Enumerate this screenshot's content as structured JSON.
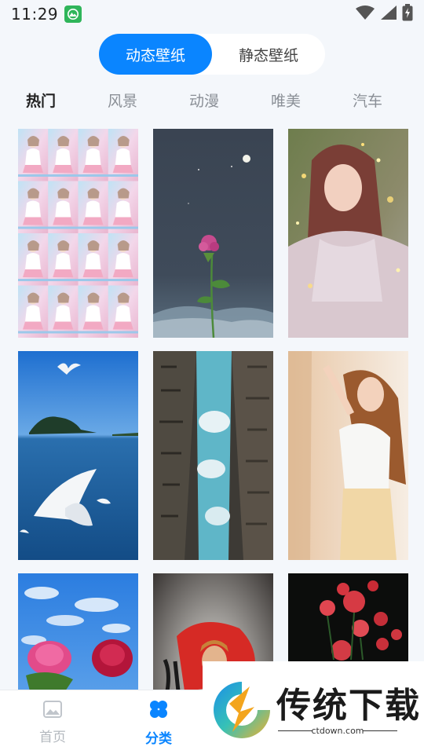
{
  "status_bar": {
    "time": "11:29",
    "app_icon": "mountain-app-icon",
    "icons": [
      "wifi-icon",
      "signal-icon",
      "battery-charging-icon"
    ]
  },
  "segment": {
    "active": "动态壁纸",
    "inactive": "静态壁纸",
    "accent": "#0a85ff"
  },
  "categories": [
    "热门",
    "风景",
    "动漫",
    "唯美",
    "汽车"
  ],
  "active_category": "热门",
  "wallpapers": [
    {
      "subject": "girl-collage",
      "icon": "wallpaper-thumbnail"
    },
    {
      "subject": "flower-night-moon",
      "icon": "wallpaper-thumbnail"
    },
    {
      "subject": "girl-sweater-sparkle",
      "icon": "wallpaper-thumbnail"
    },
    {
      "subject": "seagulls-lake-island",
      "icon": "wallpaper-thumbnail"
    },
    {
      "subject": "city-buildings-sky",
      "icon": "wallpaper-thumbnail"
    },
    {
      "subject": "girl-white-top",
      "icon": "wallpaper-thumbnail"
    },
    {
      "subject": "roses-blue-sky",
      "icon": "wallpaper-thumbnail"
    },
    {
      "subject": "portrait-red-splash",
      "icon": "wallpaper-thumbnail"
    },
    {
      "subject": "red-roses-dark",
      "icon": "wallpaper-thumbnail"
    }
  ],
  "bottom_nav": {
    "home": "首页",
    "category": "分类",
    "active": "分类"
  },
  "watermark": {
    "text": "传统下载",
    "url": "ctdown.com"
  }
}
